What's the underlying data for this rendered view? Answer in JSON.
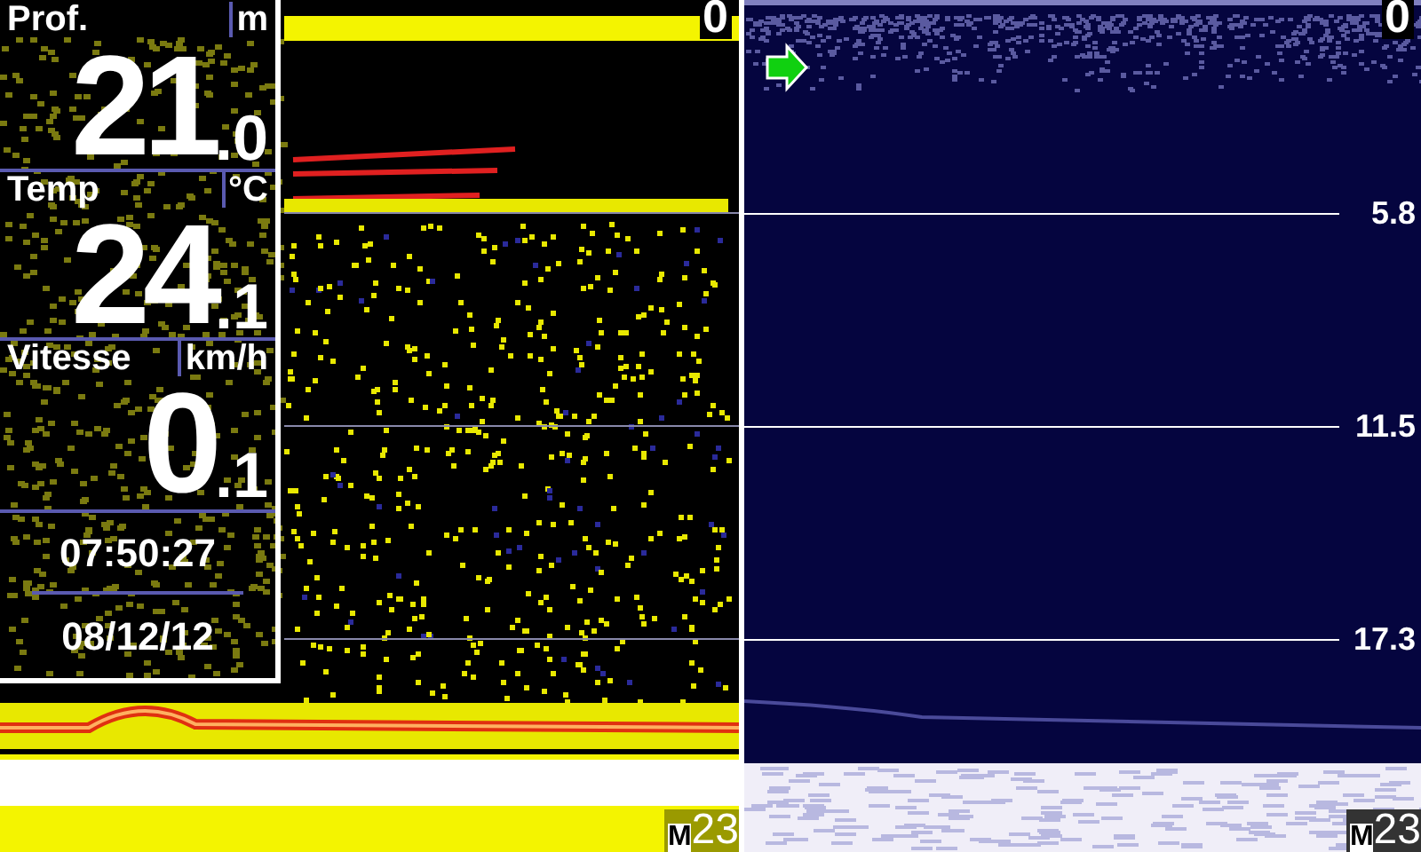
{
  "data_panel": {
    "readouts": [
      {
        "label": "Prof.",
        "unit": "m",
        "whole": "21",
        "decimal": ".0"
      },
      {
        "label": "Temp",
        "unit": "°C",
        "whole": "24",
        "decimal": ".1"
      },
      {
        "label": "Vitesse",
        "unit": "km/h",
        "whole": "0",
        "decimal": ".1"
      }
    ],
    "time": "07:50:27",
    "date": "08/12/12"
  },
  "left_view": {
    "top_depth": "0",
    "zoom_label": "M",
    "zoom_value": "23"
  },
  "right_view": {
    "top_depth": "0",
    "depth_marks": [
      "5.8",
      "11.5",
      "17.3"
    ],
    "zoom_label": "M",
    "zoom_value": "23"
  }
}
